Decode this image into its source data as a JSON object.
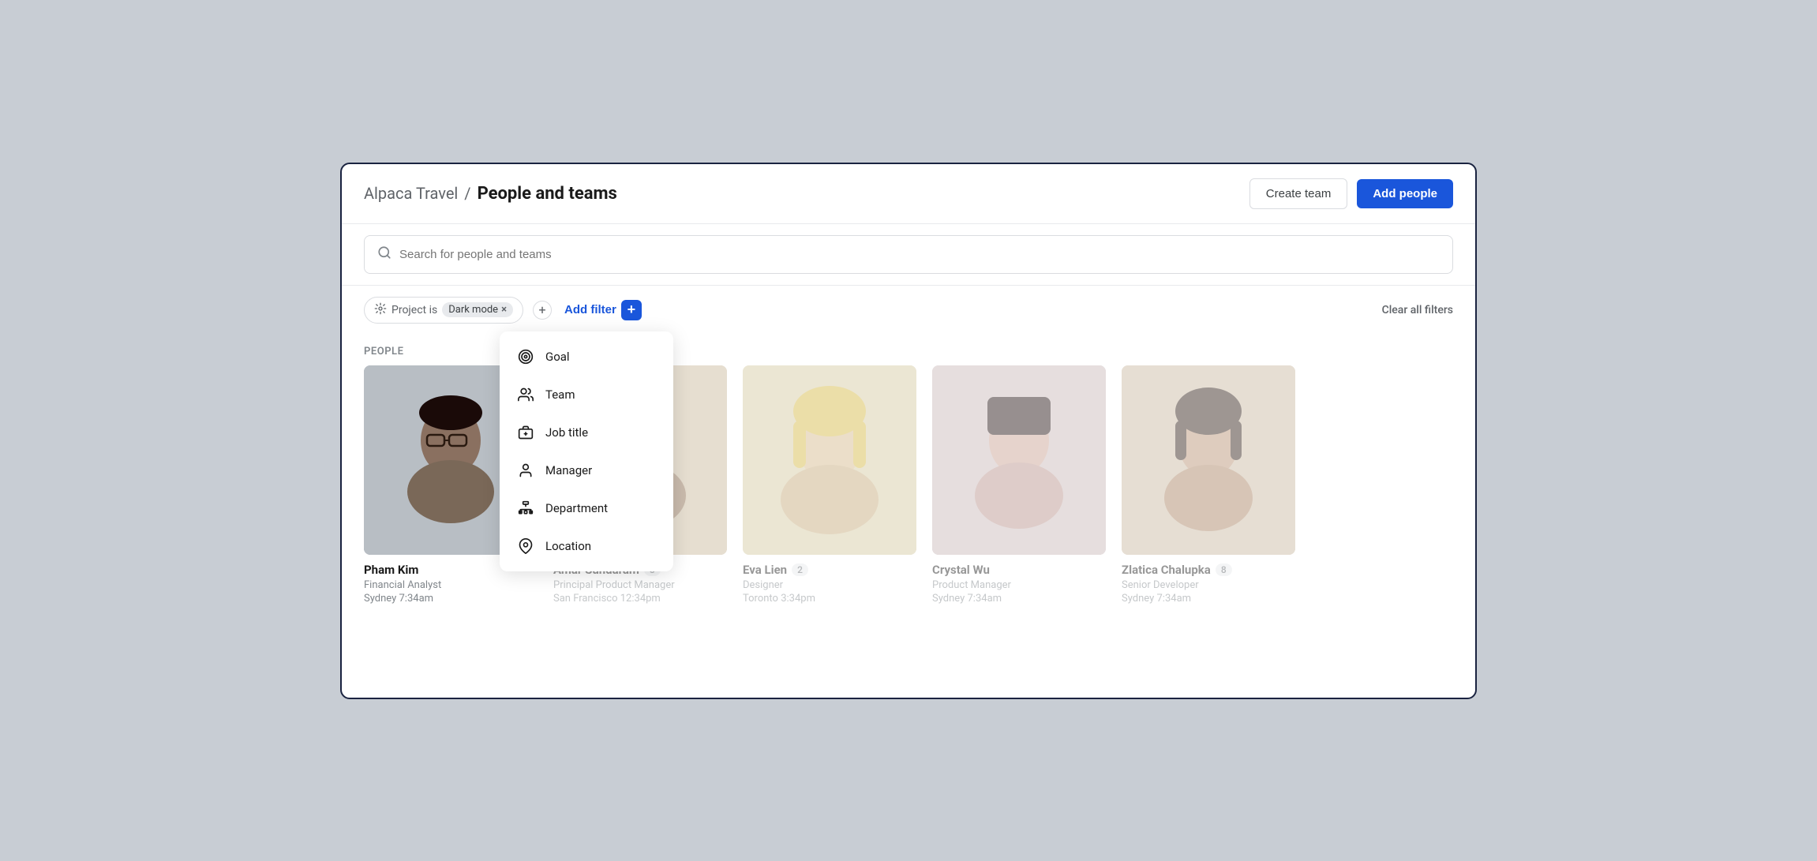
{
  "header": {
    "breadcrumb_parent": "Alpaca Travel",
    "breadcrumb_sep": "/",
    "breadcrumb_current": "People and teams",
    "create_team_label": "Create team",
    "add_people_label": "Add people"
  },
  "search": {
    "placeholder": "Search for people and teams"
  },
  "filter_bar": {
    "project_label": "Project is",
    "filter_value": "Dark mode",
    "add_filter_label": "Add filter",
    "clear_all_label": "Clear all filters"
  },
  "dropdown": {
    "items": [
      {
        "id": "goal",
        "label": "Goal",
        "icon": "goal-icon"
      },
      {
        "id": "team",
        "label": "Team",
        "icon": "team-icon"
      },
      {
        "id": "job-title",
        "label": "Job title",
        "icon": "job-title-icon"
      },
      {
        "id": "manager",
        "label": "Manager",
        "icon": "manager-icon"
      },
      {
        "id": "department",
        "label": "Department",
        "icon": "department-icon"
      },
      {
        "id": "location",
        "label": "Location",
        "icon": "location-icon"
      }
    ]
  },
  "people_section": {
    "label": "People",
    "people": [
      {
        "id": "pham-kim",
        "name": "Pham Kim",
        "badge": null,
        "role": "Financial Analyst",
        "location": "Sydney",
        "time": "7:34am",
        "avatar_class": "avatar-pham"
      },
      {
        "id": "amar-sundaram",
        "name": "Amar Sundaram",
        "badge": "8",
        "role": "Principal Product Manager",
        "location": "San Francisco",
        "time": "12:34pm",
        "avatar_class": "avatar-amar"
      },
      {
        "id": "eva-lien",
        "name": "Eva Lien",
        "badge": "2",
        "role": "Designer",
        "location": "Toronto",
        "time": "3:34pm",
        "avatar_class": "avatar-eva"
      },
      {
        "id": "crystal-wu",
        "name": "Crystal Wu",
        "badge": null,
        "role": "Product Manager",
        "location": "Sydney",
        "time": "7:34am",
        "avatar_class": "avatar-crystal"
      },
      {
        "id": "zlatica-chalupka",
        "name": "Zlatica Chalupka",
        "badge": "8",
        "role": "Senior Developer",
        "location": "Sydney",
        "time": "7:34am",
        "avatar_class": "avatar-zlatica"
      }
    ]
  }
}
